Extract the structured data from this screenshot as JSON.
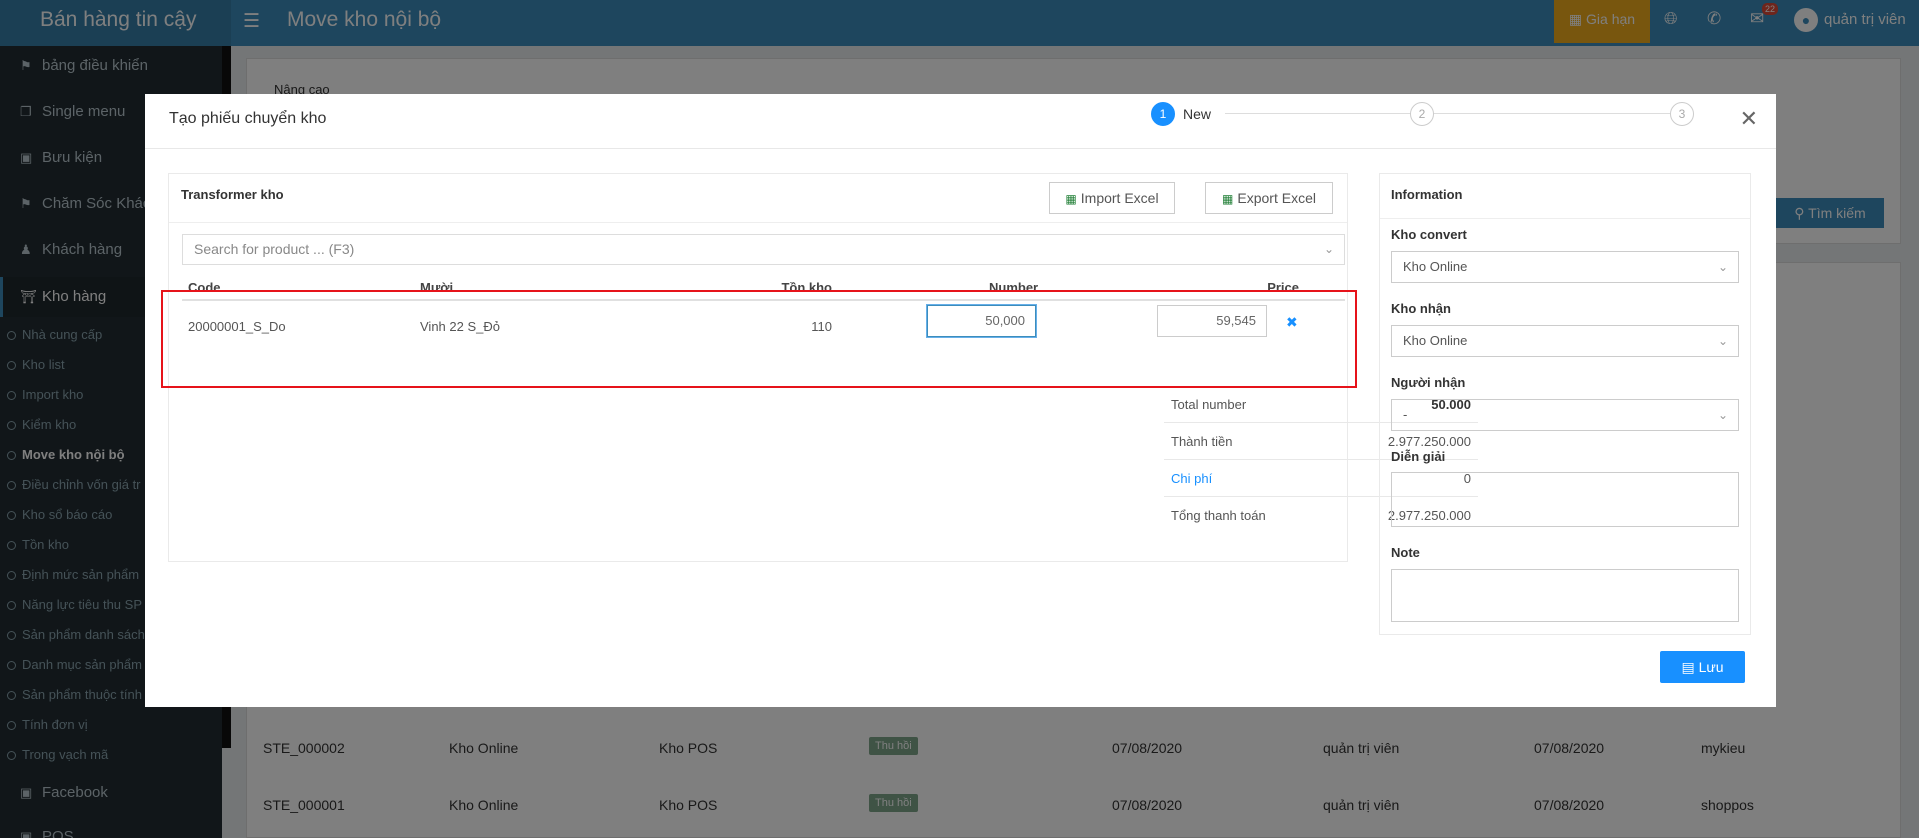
{
  "app": {
    "brand": "Bán hàng tin cậy",
    "page_title": "Move kho nội bộ"
  },
  "topbar": {
    "renew_label": "Gia hạn",
    "notif_count": "22",
    "user_name": "quản trị viên"
  },
  "sidebar": {
    "items": [
      {
        "label": "bảng điều khiển",
        "icon": "flag-icon"
      },
      {
        "label": "Single menu",
        "icon": "copy-icon"
      },
      {
        "label": "Bưu kiện",
        "icon": "truck-icon"
      },
      {
        "label": "Chăm Sóc Khác",
        "icon": "flag-icon"
      },
      {
        "label": "Khách hàng",
        "icon": "users-icon"
      },
      {
        "label": "Kho hàng",
        "icon": "bank-icon"
      }
    ],
    "subitems": [
      "Nhà cung cấp",
      "Kho list",
      "Import kho",
      "Kiểm kho",
      "Move kho nội bộ",
      "Điều chỉnh vốn giá tr",
      "Kho sổ báo cáo",
      "Tồn kho",
      "Định mức sản phẩm",
      "Năng lực tiêu thu SP",
      "Sản phẩm danh sách",
      "Danh mục sản phẩm",
      "Sản phẩm thuộc tính",
      "Tính đơn vị",
      "Trong vạch mã"
    ],
    "bottom_items": [
      {
        "label": "Facebook",
        "icon": "facebook-icon"
      },
      {
        "label": "POS",
        "icon": "pos-icon"
      }
    ]
  },
  "background": {
    "filter_label": "Nâng cao",
    "search_button": "Tìm kiếm",
    "rows": [
      {
        "code": "STE_000002",
        "from": "Kho Online",
        "to": "Kho POS",
        "status": "Thu hồi",
        "date1": "07/08/2020",
        "user": "quản trị viên",
        "date2": "07/08/2020",
        "creator": "mykieu"
      },
      {
        "code": "STE_000001",
        "from": "Kho Online",
        "to": "Kho POS",
        "status": "Thu hồi",
        "date1": "07/08/2020",
        "user": "quản trị viên",
        "date2": "07/08/2020",
        "creator": "shoppos"
      }
    ]
  },
  "modal": {
    "title": "Tạo phiếu chuyển kho",
    "steps": [
      {
        "num": "1",
        "label": "New"
      },
      {
        "num": "2"
      },
      {
        "num": "3"
      }
    ],
    "left_panel": {
      "title": "Transformer kho",
      "import_label": "Import Excel",
      "export_label": "Export Excel",
      "search_placeholder": "Search for product ... (F3)",
      "columns": {
        "code": "Code",
        "name": "Mười",
        "stock": "Tồn kho",
        "number": "Number",
        "price": "Price"
      },
      "row": {
        "code": "20000001_S_Do",
        "name": "Vinh 22 S_Đỏ",
        "stock": "110",
        "number": "50,000",
        "price": "59,545"
      }
    },
    "summary": [
      {
        "label": "Total number",
        "value": "50.000"
      },
      {
        "label": "Thành tiền",
        "value": "2.977.250.000"
      },
      {
        "label": "Chi phí",
        "value": "0"
      },
      {
        "label": "Tổng thanh toán",
        "value": "2.977.250.000"
      }
    ],
    "info": {
      "title": "Information",
      "kho_convert_label": "Kho convert",
      "kho_convert_value": "Kho Online",
      "kho_nhan_label": "Kho nhận",
      "kho_nhan_value": "Kho Online",
      "nguoi_nhan_label": "Người nhận",
      "nguoi_nhan_value": "-",
      "dien_giai_label": "Diễn giải",
      "note_label": "Note"
    },
    "save_label": "Lưu"
  },
  "colors": {
    "header": "#3c8dbc",
    "sidebar": "#222d32",
    "primary": "#1890ff",
    "highlight": "#e6131a",
    "renew": "#f0ad1d"
  }
}
